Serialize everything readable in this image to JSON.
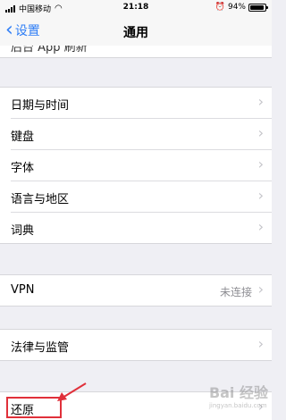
{
  "status": {
    "carrier": "中国移动",
    "time": "21:18",
    "battery": "94%",
    "battery_level": 0.94
  },
  "nav": {
    "back_label": "设置",
    "title": "通用"
  },
  "partial_row": {
    "label": "后台 App 刷新"
  },
  "group1": [
    {
      "label": "日期与时间"
    },
    {
      "label": "键盘"
    },
    {
      "label": "字体"
    },
    {
      "label": "语言与地区"
    },
    {
      "label": "词典"
    }
  ],
  "vpn": {
    "label": "VPN",
    "value": "未连接"
  },
  "legal": {
    "label": "法律与监管"
  },
  "reset": {
    "label": "还原"
  },
  "watermark": {
    "text": "Bai 经验",
    "url": "jingyan.baidu.com"
  }
}
